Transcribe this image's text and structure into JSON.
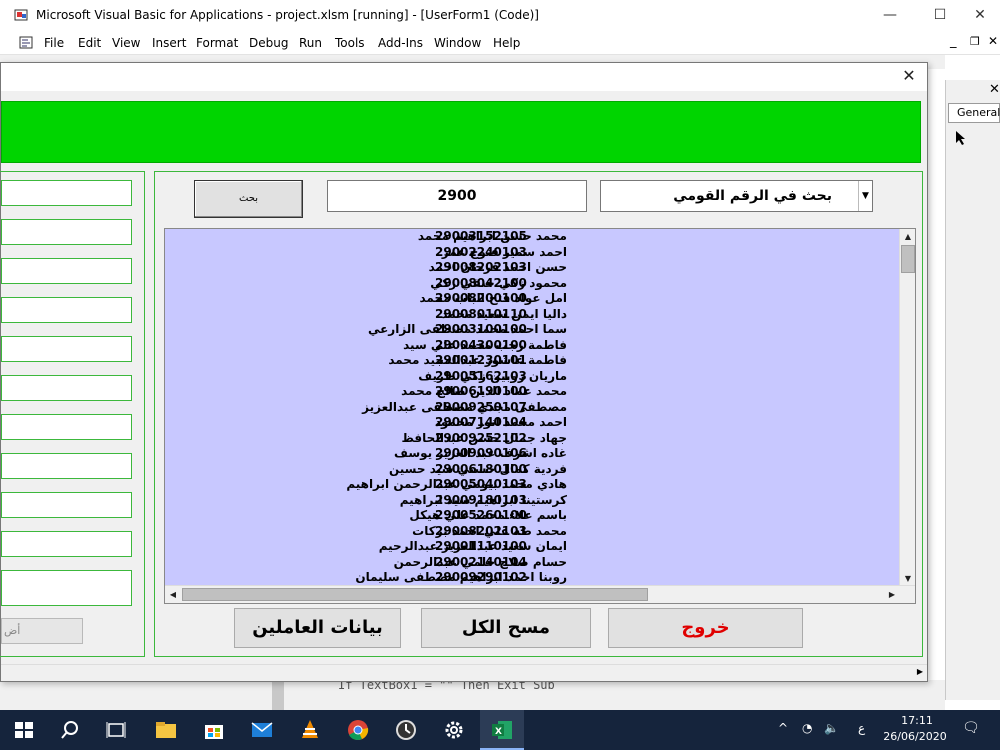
{
  "ide": {
    "title": "Microsoft Visual Basic for Applications - project.xlsm [running] - [UserForm1 (Code)]",
    "menus": [
      "File",
      "Edit",
      "View",
      "Insert",
      "Format",
      "Debug",
      "Run",
      "Tools",
      "Add-Ins",
      "Window",
      "Help"
    ],
    "general_label": "General",
    "code_snippet": "If TextBox1 = \"\" Then Exit Sub"
  },
  "form": {
    "search_button_label": "بحث",
    "search_value": "2900",
    "search_mode": "بحث في الرقم القومي",
    "left_action_label": "أض",
    "buttons": {
      "employees": "بيانات العاملين",
      "clear_all": "مسح الكل",
      "exit": "خروج"
    },
    "exit_color": "#e00000",
    "list": [
      {
        "name": "محمد حسن ابراهيم محمد",
        "id": "29003152105"
      },
      {
        "name": "احمد سمير فتوح عمر",
        "id": "29002240103"
      },
      {
        "name": "حسن احمد فرحان احمد",
        "id": "29008202103"
      },
      {
        "name": "محمود زكي حنفي زكي",
        "id": "29008042100"
      },
      {
        "name": "امل عواد فتح الباب محمد",
        "id": "29008200100"
      },
      {
        "name": "داليا ايمن سعيد محمد",
        "id": "29008010110"
      },
      {
        "name": "سما احمد محمد مصطفى الزارعي",
        "id": "29003100100"
      },
      {
        "name": "فاطمة رجب محمد علي سيد",
        "id": "29004300100"
      },
      {
        "name": "فاطمة عاشور عبدالمجيد محمد",
        "id": "29001230101"
      },
      {
        "name": "ماريان روبين زكي ظريف",
        "id": "29005162103"
      },
      {
        "name": "محمد عماد الدين صالح محمد",
        "id": "29006190100"
      },
      {
        "name": "مصطفى مجدي مصطفى عبدالعزيز",
        "id": "29009250107"
      },
      {
        "name": "احمد محمد انور محمود",
        "id": "29007140104"
      },
      {
        "name": "جهاد جمال حسن عبدالحافظ",
        "id": "29009252102"
      },
      {
        "name": "غاده اشرف عبد العزيز يوسف",
        "id": "29009090106"
      },
      {
        "name": "فردية كمال حسني سيد حسين",
        "id": "29006180100"
      },
      {
        "name": "هادي محمد بيومي عبدالرحمن ابراهيم",
        "id": "29005040103"
      },
      {
        "name": "كرستينا ابراهيم سيد ابراهيم",
        "id": "29009180103"
      },
      {
        "name": "باسم علاء محمد علي هيكل",
        "id": "29005260100"
      },
      {
        "name": "محمد طه علي احمد بركات",
        "id": "29008202103"
      },
      {
        "name": "ايمان سعيد عبدالعزيز عبدالرحيم",
        "id": "29001110100"
      },
      {
        "name": "حسام صلاح حلمي عبدالرحمن",
        "id": "29002140104"
      },
      {
        "name": "روبنا احمد ابراهيم مصطفى سليمان",
        "id": "29009290102"
      }
    ]
  },
  "taskbar": {
    "time": "17:11",
    "date": "26/06/2020",
    "lang": "ع"
  }
}
